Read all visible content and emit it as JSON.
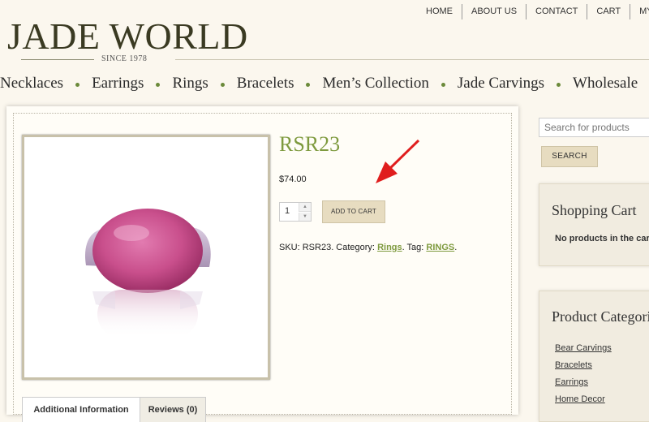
{
  "topnav": [
    "HOME",
    "ABOUT US",
    "CONTACT",
    "CART",
    "MY AC"
  ],
  "logo": {
    "name": "JADE WORLD",
    "tagline": "SINCE 1978"
  },
  "catnav": [
    "Necklaces",
    "Earrings",
    "Rings",
    "Bracelets",
    "Men’s Collection",
    "Jade Carvings",
    "Wholesale"
  ],
  "product": {
    "title": "RSR23",
    "price": "$74.00",
    "quantity": "1",
    "add_to_cart": "ADD TO CART",
    "meta": {
      "sku_label": "SKU: RSR23. Category: ",
      "category": "Rings",
      "tag_label": ". Tag: ",
      "tag": "RINGS",
      "end": "."
    }
  },
  "tabs": [
    "Additional Information",
    "Reviews (0)"
  ],
  "sidebar": {
    "search_placeholder": "Search for products",
    "search_button": "SEARCH",
    "cart": {
      "title": "Shopping Cart",
      "empty": "No products in the cart"
    },
    "categories": {
      "title": "Product Categories",
      "items": [
        "Bear Carvings",
        "Bracelets",
        "Earrings",
        "Home Decor"
      ]
    }
  },
  "colors": {
    "accent_green": "#7e9a3e",
    "button_beige": "#e7dcc0",
    "background": "#fbf7ee",
    "annotation_arrow": "#e01e1e",
    "ring_stone": "#c94f8c"
  }
}
